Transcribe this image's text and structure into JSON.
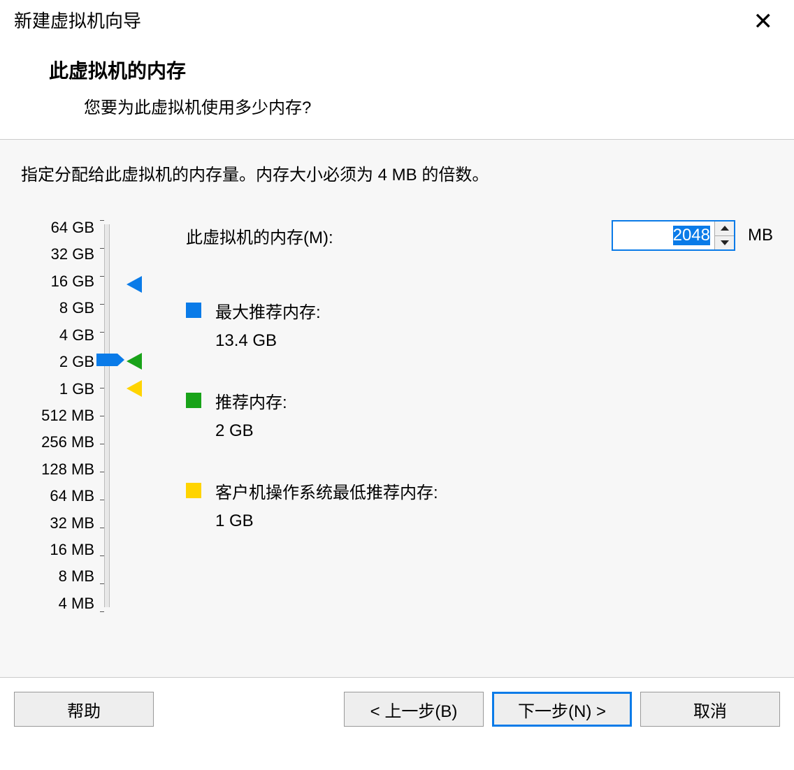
{
  "titlebar": {
    "title": "新建虚拟机向导"
  },
  "header": {
    "title": "此虚拟机的内存",
    "subtitle": "您要为此虚拟机使用多少内存?"
  },
  "instruction": "指定分配给此虚拟机的内存量。内存大小必须为 4 MB 的倍数。",
  "memory": {
    "label": "此虚拟机的内存(M):",
    "value": "2048",
    "unit": "MB"
  },
  "slider": {
    "ticks": [
      "64 GB",
      "32 GB",
      "16 GB",
      "8 GB",
      "4 GB",
      "2 GB",
      "1 GB",
      "512 MB",
      "256 MB",
      "128 MB",
      "64 MB",
      "32 MB",
      "16 MB",
      "8 MB",
      "4 MB"
    ],
    "thumb_index": 5,
    "markers": {
      "blue_pct": 16.5,
      "green_pct": 36,
      "yellow_pct": 43
    }
  },
  "legend": {
    "max": {
      "label": "最大推荐内存:",
      "value": "13.4 GB"
    },
    "rec": {
      "label": "推荐内存:",
      "value": "2 GB"
    },
    "min": {
      "label": "客户机操作系统最低推荐内存:",
      "value": "1 GB"
    }
  },
  "footer": {
    "help": "帮助",
    "back": "< 上一步(B)",
    "next": "下一步(N) >",
    "cancel": "取消"
  }
}
